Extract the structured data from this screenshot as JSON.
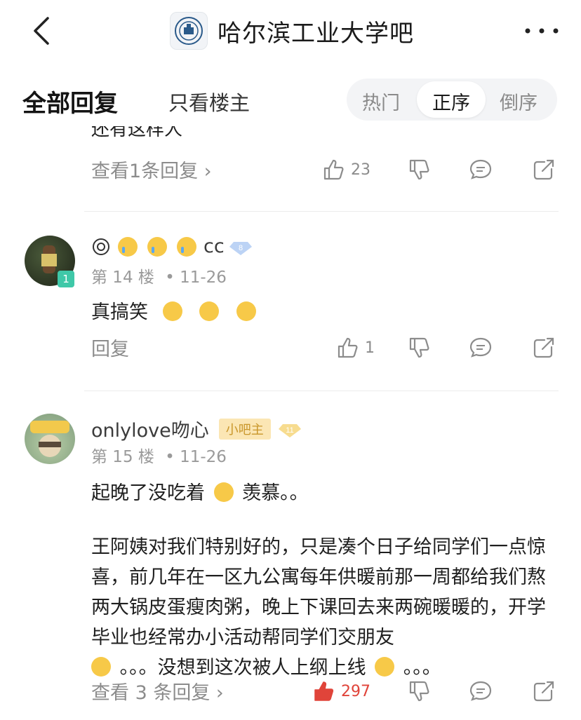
{
  "header": {
    "title": "哈尔滨工业大学吧"
  },
  "tabs": {
    "all": "全部回复",
    "owner_only": "只看楼主",
    "sort_hot": "热门",
    "sort_asc": "正序",
    "sort_desc": "倒序"
  },
  "prev_post": {
    "cutoff_text": "还有这样人",
    "reply_link": "查看1条回复 ›",
    "likes": "23"
  },
  "post14": {
    "username": "cc",
    "level": "8",
    "avatar_badge": "1",
    "floor": "第 14 楼",
    "date": "• 11-26",
    "content": "真搞笑",
    "reply_link": "回复",
    "likes": "1"
  },
  "post15": {
    "username": "onlylove吻心",
    "role_badge": "小吧主",
    "level": "11",
    "floor": "第 15 楼",
    "date": "• 11-26",
    "content_line1": "起晚了没吃着",
    "content_line1_tail": "羡慕。。",
    "content_para2": "王阿姨对我们特别好的，只是凑个日子给同学们一点惊喜，前几年在一区九公寓每年供暖前那一周都给我们熬两大锅皮蛋瘦肉粥，晚上下课回去来两碗暖暖的，开学毕业也经常办小活动帮同学们交朋友",
    "content_tail_a": "。。。没想到这次被人上纲上线",
    "content_tail_b": "。。。",
    "reply_link": "查看 3 条回复 ›",
    "likes": "297"
  },
  "colors": {
    "liked": "#e0443a",
    "muted": "#8c8c8c",
    "moderator": "#c9962a"
  },
  "icons": [
    "back-icon",
    "more-icon",
    "like-icon",
    "dislike-icon",
    "comment-icon",
    "share-icon",
    "emoji-icon"
  ]
}
